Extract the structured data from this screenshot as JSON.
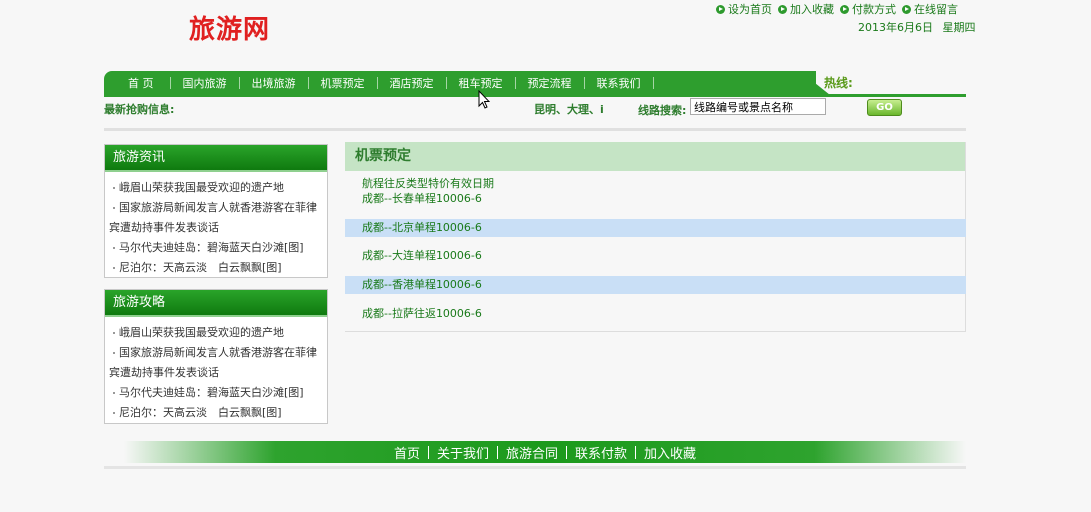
{
  "header": {
    "logo": "旅游网",
    "top_links": [
      "设为首页",
      "加入收藏",
      "付款方式",
      "在线留言"
    ],
    "date": "2013年6月6日",
    "weekday": "星期四"
  },
  "nav": {
    "items": [
      "首 页",
      "国内旅游",
      "出境旅游",
      "机票预定",
      "酒店预定",
      "租车预定",
      "预定流程",
      "联系我们"
    ],
    "hotline_label": "热线:"
  },
  "bar": {
    "deals_label": "最新抢购信息:",
    "destinations": "昆明、大理、i",
    "search_label": "线路搜索:",
    "search_value": "线路编号或景点名称",
    "go_label": "GO"
  },
  "sidebar": {
    "news": {
      "title": "旅游资讯",
      "items": [
        "峨眉山荣获我国最受欢迎的遗产地",
        "国家旅游局新闻发言人就香港游客在菲律",
        "宾遭劫持事件发表谈话",
        "马尔代夫迪娃岛：碧海蓝天白沙滩[图]",
        "尼泊尔：天高云淡　白云飘飘[图]"
      ]
    },
    "guide": {
      "title": "旅游攻略",
      "items": [
        "峨眉山荣获我国最受欢迎的遗产地",
        "国家旅游局新闻发言人就香港游客在菲律",
        "宾遭劫持事件发表谈话",
        "马尔代夫迪娃岛：碧海蓝天白沙滩[图]",
        "尼泊尔：天高云淡　白云飘飘[图]"
      ]
    }
  },
  "main": {
    "title": "机票预定",
    "columns": "航程往反类型特价有效日期",
    "flights": [
      "成都--长春单程10006-6",
      "成都--北京单程10006-6",
      "成都--大连单程10006-6",
      "成都--香港单程10006-6",
      "成都--拉萨往返10006-6"
    ]
  },
  "footer": {
    "links": [
      "首页",
      "关于我们",
      "旅游合同",
      "联系付款",
      "加入收藏"
    ]
  },
  "colors": {
    "brand_green": "#2e9e2e",
    "logo_red": "#e02020",
    "highlight_row": "#c9dff6"
  }
}
